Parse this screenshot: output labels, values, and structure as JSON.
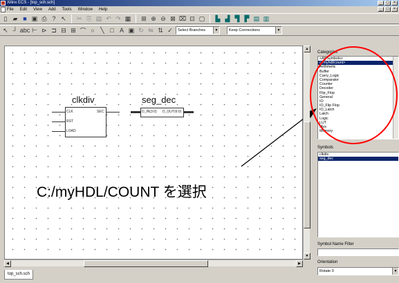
{
  "window": {
    "title": "Xilinx ECS - [top_sch.sch]"
  },
  "menubar": {
    "items": [
      "File",
      "Edit",
      "View",
      "Add",
      "Tools",
      "Window",
      "Help"
    ]
  },
  "toolbar2": {
    "branch_select": "Select Branches",
    "connection_select": "Keep Connections"
  },
  "schematic": {
    "symbols": [
      {
        "name": "clkdiv",
        "pins_left": [
          "CLK",
          "RST",
          "LOAD"
        ],
        "pins_right": [
          "SEC"
        ]
      },
      {
        "name": "seg_dec",
        "pins_left": [
          "D_IN(3:0)"
        ],
        "pins_right": [
          "D_OUT(6:0)"
        ]
      }
    ],
    "annotation": "C:/myHDL/COUNT を選択"
  },
  "tabs": [
    "top_sch.sch"
  ],
  "panel": {
    "categories_label": "Categories",
    "categories": [
      "<All Symbols>",
      "c:/myhdl/count>",
      "Arithmetic",
      "Buffer",
      "Carry_Logic",
      "Comparator",
      "Counter",
      "Decoder",
      "Flip_Flop",
      "General",
      "IO",
      "IO_Flip Flop",
      "IO_Latch",
      "Latch",
      "Logic",
      "LUT",
      "Mux",
      "Memory"
    ],
    "categories_selected_index": 1,
    "symbols_label": "Symbols",
    "symbols": [
      "clkdiv",
      "seg_dec"
    ],
    "symbols_selected_index": 1,
    "name_filter_label": "Symbol Name Filter",
    "name_filter_value": "",
    "orientation_label": "Orientation",
    "orientation_value": "Rotate 0"
  },
  "colors": {
    "highlight_circle": "#ff0000",
    "selection": "#0a246a"
  }
}
